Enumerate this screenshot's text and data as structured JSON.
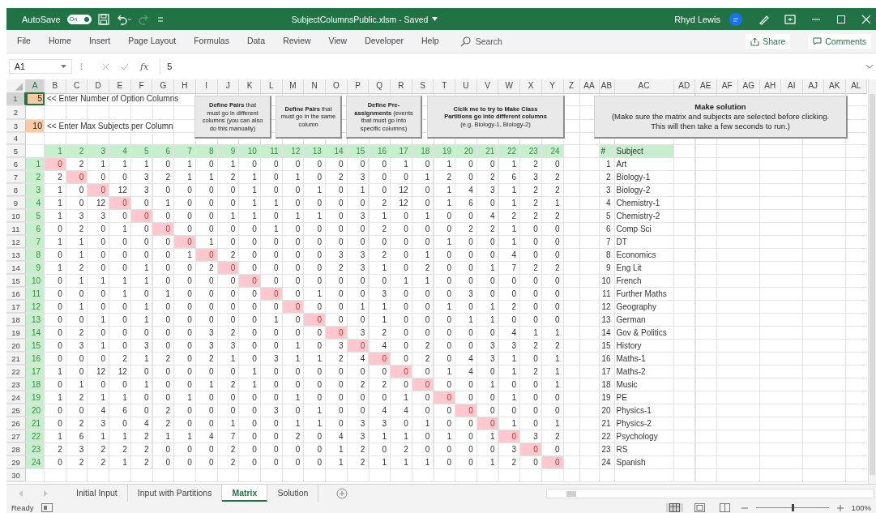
{
  "title_bar": {
    "autosave_label": "AutoSave",
    "autosave_on": true,
    "toggle_text": "On",
    "document_title": "SubjectColumnsPublic.xlsm  -  Saved",
    "user": "Rhyd Lewis"
  },
  "ribbon": {
    "tabs": [
      {
        "label": "File",
        "selected": false
      },
      {
        "label": "Home",
        "selected": false
      },
      {
        "label": "Insert",
        "selected": false
      },
      {
        "label": "Page Layout",
        "selected": false
      },
      {
        "label": "Formulas",
        "selected": false
      },
      {
        "label": "Data",
        "selected": false
      },
      {
        "label": "Review",
        "selected": false
      },
      {
        "label": "View",
        "selected": false
      },
      {
        "label": "Developer",
        "selected": false
      },
      {
        "label": "Help",
        "selected": false
      }
    ],
    "search_placeholder": "Search",
    "share": "Share",
    "comments": "Comments"
  },
  "formula_bar": {
    "name_box": "A1",
    "fx": "fx",
    "value": "5"
  },
  "sheet": {
    "columns": [
      {
        "label": "A",
        "selected": true
      },
      {
        "label": "B",
        "selected": false
      },
      {
        "label": "C",
        "selected": false
      },
      {
        "label": "D",
        "selected": false
      },
      {
        "label": "E",
        "selected": false
      },
      {
        "label": "F",
        "selected": false
      },
      {
        "label": "G",
        "selected": false
      },
      {
        "label": "H",
        "selected": false
      },
      {
        "label": "I",
        "selected": false
      },
      {
        "label": "J",
        "selected": false
      },
      {
        "label": "K",
        "selected": false
      },
      {
        "label": "L",
        "selected": false
      },
      {
        "label": "M",
        "selected": false
      },
      {
        "label": "N",
        "selected": false
      },
      {
        "label": "O",
        "selected": false
      },
      {
        "label": "P",
        "selected": false
      },
      {
        "label": "Q",
        "selected": false
      },
      {
        "label": "R",
        "selected": false
      },
      {
        "label": "S",
        "selected": false
      },
      {
        "label": "T",
        "selected": false
      },
      {
        "label": "U",
        "selected": false
      },
      {
        "label": "V",
        "selected": false
      },
      {
        "label": "W",
        "selected": false
      },
      {
        "label": "X",
        "selected": false
      },
      {
        "label": "Y",
        "selected": false
      },
      {
        "label": "Z",
        "selected": false
      },
      {
        "label": "AA",
        "selected": false
      },
      {
        "label": "AB",
        "selected": false
      },
      {
        "label": "AC",
        "selected": false
      },
      {
        "label": "AD",
        "selected": false
      },
      {
        "label": "AE",
        "selected": false
      },
      {
        "label": "AF",
        "selected": false
      },
      {
        "label": "AG",
        "selected": false
      },
      {
        "label": "AH",
        "selected": false
      },
      {
        "label": "AI",
        "selected": false
      },
      {
        "label": "AJ",
        "selected": false
      },
      {
        "label": "AK",
        "selected": false
      },
      {
        "label": "AL",
        "selected": false
      }
    ],
    "rows": [
      {
        "label": "1",
        "selected": true
      },
      {
        "label": "2",
        "selected": false
      },
      {
        "label": "3",
        "selected": false
      },
      {
        "label": "4",
        "selected": false
      },
      {
        "label": "5",
        "selected": false
      },
      {
        "label": "6",
        "selected": false
      },
      {
        "label": "7",
        "selected": false
      },
      {
        "label": "8",
        "selected": false
      },
      {
        "label": "9",
        "selected": false
      },
      {
        "label": "10",
        "selected": false
      },
      {
        "label": "11",
        "selected": false
      },
      {
        "label": "12",
        "selected": false
      },
      {
        "label": "13",
        "selected": false
      },
      {
        "label": "14",
        "selected": false
      },
      {
        "label": "15",
        "selected": false
      },
      {
        "label": "16",
        "selected": false
      },
      {
        "label": "17",
        "selected": false
      },
      {
        "label": "18",
        "selected": false
      },
      {
        "label": "19",
        "selected": false
      },
      {
        "label": "20",
        "selected": false
      },
      {
        "label": "21",
        "selected": false
      },
      {
        "label": "22",
        "selected": false
      },
      {
        "label": "23",
        "selected": false
      },
      {
        "label": "24",
        "selected": false
      },
      {
        "label": "25",
        "selected": false
      },
      {
        "label": "26",
        "selected": false
      },
      {
        "label": "27",
        "selected": false
      },
      {
        "label": "28",
        "selected": false
      },
      {
        "label": "29",
        "selected": false
      },
      {
        "label": "30",
        "selected": false
      }
    ],
    "inputs": [
      {
        "value": "5",
        "note": "<< Enter Number of Option Columns",
        "selected": true
      },
      {
        "value": "10",
        "note": "<< Enter Max Subjects per Column",
        "selected": false
      }
    ],
    "macro_buttons": [
      {
        "lines": [
          "**Define Pairs** that",
          "must go in different",
          "columns (you can also",
          "do this manually)"
        ]
      },
      {
        "lines": [
          "**Define Pairs** that",
          "must go in the same",
          "column"
        ]
      },
      {
        "lines": [
          "**Define Pre-**",
          "**assignments** (events",
          "that must go into",
          "specific columns)"
        ]
      },
      {
        "lines": [
          "**Clcik me to try to Make Class**",
          "**Partitions go into different columns**",
          "(e.g. Biology-1, Biology-2)"
        ]
      },
      {
        "lines": [
          "**Make solution**",
          "(Make sure the matrix and subjects are selected before clicking.",
          "This will then take a few seconds to run.)"
        ]
      }
    ],
    "matrix": {
      "diagonal_highlighted": true,
      "headers": [
        "1",
        "2",
        "3",
        "4",
        "5",
        "6",
        "7",
        "8",
        "9",
        "10",
        "11",
        "12",
        "13",
        "14",
        "15",
        "16",
        "17",
        "18",
        "19",
        "20",
        "21",
        "22",
        "23",
        "24"
      ],
      "rows": [
        {
          "label": "1",
          "values": [
            "0",
            "2",
            "1",
            "1",
            "1",
            "0",
            "1",
            "0",
            "1",
            "0",
            "0",
            "0",
            "0",
            "0",
            "0",
            "0",
            "1",
            "0",
            "1",
            "0",
            "0",
            "1",
            "2",
            "0"
          ]
        },
        {
          "label": "2",
          "values": [
            "2",
            "0",
            "0",
            "0",
            "3",
            "2",
            "1",
            "1",
            "2",
            "1",
            "0",
            "1",
            "0",
            "2",
            "3",
            "0",
            "0",
            "1",
            "2",
            "0",
            "2",
            "6",
            "3",
            "2"
          ]
        },
        {
          "label": "3",
          "values": [
            "1",
            "0",
            "0",
            "12",
            "3",
            "0",
            "0",
            "0",
            "0",
            "1",
            "0",
            "0",
            "1",
            "0",
            "1",
            "0",
            "12",
            "0",
            "1",
            "4",
            "3",
            "1",
            "2",
            "2"
          ]
        },
        {
          "label": "4",
          "values": [
            "1",
            "0",
            "12",
            "0",
            "0",
            "1",
            "0",
            "0",
            "0",
            "1",
            "1",
            "0",
            "0",
            "0",
            "0",
            "2",
            "12",
            "0",
            "1",
            "6",
            "0",
            "1",
            "2",
            "1"
          ]
        },
        {
          "label": "5",
          "values": [
            "1",
            "3",
            "3",
            "0",
            "0",
            "0",
            "0",
            "0",
            "1",
            "1",
            "0",
            "1",
            "1",
            "0",
            "3",
            "1",
            "0",
            "1",
            "0",
            "0",
            "4",
            "2",
            "2",
            "2"
          ]
        },
        {
          "label": "6",
          "values": [
            "0",
            "2",
            "0",
            "1",
            "0",
            "0",
            "0",
            "0",
            "0",
            "0",
            "1",
            "0",
            "0",
            "0",
            "0",
            "2",
            "0",
            "0",
            "0",
            "2",
            "2",
            "1",
            "0",
            "0"
          ]
        },
        {
          "label": "7",
          "values": [
            "1",
            "1",
            "0",
            "0",
            "0",
            "0",
            "0",
            "1",
            "0",
            "0",
            "0",
            "0",
            "0",
            "0",
            "0",
            "0",
            "0",
            "0",
            "1",
            "0",
            "0",
            "1",
            "0",
            "0"
          ]
        },
        {
          "label": "8",
          "values": [
            "0",
            "1",
            "0",
            "0",
            "0",
            "0",
            "1",
            "0",
            "2",
            "0",
            "0",
            "0",
            "0",
            "3",
            "3",
            "2",
            "0",
            "1",
            "0",
            "0",
            "0",
            "4",
            "0",
            "0"
          ]
        },
        {
          "label": "9",
          "values": [
            "1",
            "2",
            "0",
            "0",
            "1",
            "0",
            "0",
            "2",
            "0",
            "0",
            "0",
            "0",
            "0",
            "2",
            "3",
            "1",
            "0",
            "2",
            "0",
            "0",
            "1",
            "7",
            "2",
            "2"
          ]
        },
        {
          "label": "10",
          "values": [
            "0",
            "1",
            "1",
            "1",
            "1",
            "0",
            "0",
            "0",
            "0",
            "0",
            "0",
            "0",
            "0",
            "0",
            "0",
            "0",
            "1",
            "1",
            "0",
            "0",
            "0",
            "0",
            "0",
            "0"
          ]
        },
        {
          "label": "11",
          "values": [
            "0",
            "0",
            "0",
            "1",
            "0",
            "1",
            "0",
            "0",
            "0",
            "0",
            "0",
            "0",
            "1",
            "0",
            "0",
            "3",
            "0",
            "0",
            "0",
            "3",
            "0",
            "0",
            "0",
            "0"
          ]
        },
        {
          "label": "12",
          "values": [
            "0",
            "1",
            "0",
            "0",
            "1",
            "0",
            "0",
            "0",
            "0",
            "0",
            "0",
            "0",
            "0",
            "0",
            "1",
            "1",
            "0",
            "0",
            "1",
            "0",
            "1",
            "2",
            "0",
            "0"
          ]
        },
        {
          "label": "13",
          "values": [
            "0",
            "0",
            "1",
            "0",
            "1",
            "0",
            "0",
            "0",
            "0",
            "0",
            "1",
            "0",
            "0",
            "0",
            "0",
            "1",
            "0",
            "0",
            "0",
            "1",
            "1",
            "0",
            "0",
            "0"
          ]
        },
        {
          "label": "14",
          "values": [
            "0",
            "2",
            "0",
            "0",
            "0",
            "0",
            "0",
            "3",
            "2",
            "0",
            "0",
            "0",
            "0",
            "0",
            "3",
            "2",
            "0",
            "0",
            "0",
            "0",
            "0",
            "4",
            "1",
            "1"
          ]
        },
        {
          "label": "15",
          "values": [
            "0",
            "3",
            "1",
            "0",
            "3",
            "0",
            "0",
            "3",
            "3",
            "0",
            "0",
            "1",
            "0",
            "3",
            "0",
            "4",
            "0",
            "2",
            "0",
            "0",
            "3",
            "3",
            "2",
            "2"
          ]
        },
        {
          "label": "16",
          "values": [
            "0",
            "0",
            "0",
            "2",
            "1",
            "2",
            "0",
            "2",
            "1",
            "0",
            "3",
            "1",
            "1",
            "2",
            "4",
            "0",
            "0",
            "2",
            "0",
            "4",
            "3",
            "1",
            "0",
            "1"
          ]
        },
        {
          "label": "17",
          "values": [
            "1",
            "0",
            "12",
            "12",
            "0",
            "0",
            "0",
            "0",
            "0",
            "1",
            "0",
            "0",
            "0",
            "0",
            "0",
            "0",
            "0",
            "0",
            "1",
            "4",
            "0",
            "1",
            "2",
            "1"
          ]
        },
        {
          "label": "18",
          "values": [
            "0",
            "1",
            "0",
            "0",
            "1",
            "0",
            "0",
            "1",
            "2",
            "1",
            "0",
            "0",
            "0",
            "0",
            "2",
            "2",
            "0",
            "0",
            "0",
            "0",
            "1",
            "0",
            "0",
            "1"
          ]
        },
        {
          "label": "19",
          "values": [
            "1",
            "2",
            "1",
            "1",
            "0",
            "0",
            "1",
            "0",
            "0",
            "0",
            "0",
            "1",
            "0",
            "0",
            "0",
            "0",
            "1",
            "0",
            "0",
            "0",
            "0",
            "1",
            "0",
            "0"
          ]
        },
        {
          "label": "20",
          "values": [
            "0",
            "0",
            "4",
            "6",
            "0",
            "2",
            "0",
            "0",
            "0",
            "0",
            "3",
            "0",
            "1",
            "0",
            "0",
            "4",
            "4",
            "0",
            "0",
            "0",
            "0",
            "0",
            "0",
            "0"
          ]
        },
        {
          "label": "21",
          "values": [
            "0",
            "2",
            "3",
            "0",
            "4",
            "2",
            "0",
            "0",
            "1",
            "0",
            "0",
            "1",
            "1",
            "0",
            "3",
            "3",
            "0",
            "1",
            "0",
            "0",
            "0",
            "1",
            "0",
            "1"
          ]
        },
        {
          "label": "22",
          "values": [
            "1",
            "6",
            "1",
            "1",
            "2",
            "1",
            "1",
            "4",
            "7",
            "0",
            "0",
            "2",
            "0",
            "4",
            "3",
            "1",
            "1",
            "0",
            "1",
            "0",
            "1",
            "0",
            "3",
            "2"
          ]
        },
        {
          "label": "23",
          "values": [
            "2",
            "3",
            "2",
            "2",
            "2",
            "0",
            "0",
            "0",
            "2",
            "0",
            "0",
            "0",
            "0",
            "1",
            "2",
            "0",
            "2",
            "0",
            "0",
            "0",
            "0",
            "3",
            "0",
            "0"
          ]
        },
        {
          "label": "24",
          "values": [
            "0",
            "2",
            "2",
            "1",
            "2",
            "0",
            "0",
            "0",
            "2",
            "0",
            "0",
            "0",
            "0",
            "1",
            "2",
            "1",
            "1",
            "1",
            "0",
            "0",
            "1",
            "2",
            "0",
            "0"
          ]
        }
      ]
    },
    "subjects": {
      "number_heading": "#",
      "name_heading": "Subject",
      "items": [
        {
          "number": "1",
          "name": "Art"
        },
        {
          "number": "2",
          "name": "Biology-1"
        },
        {
          "number": "3",
          "name": "Biology-2"
        },
        {
          "number": "4",
          "name": "Chemistry-1"
        },
        {
          "number": "5",
          "name": "Chemistry-2"
        },
        {
          "number": "6",
          "name": "Comp Sci"
        },
        {
          "number": "7",
          "name": "DT"
        },
        {
          "number": "8",
          "name": "Economics"
        },
        {
          "number": "9",
          "name": "Eng Lit"
        },
        {
          "number": "10",
          "name": "French"
        },
        {
          "number": "11",
          "name": "Further Maths"
        },
        {
          "number": "12",
          "name": "Geography"
        },
        {
          "number": "13",
          "name": "German"
        },
        {
          "number": "14",
          "name": "Gov & Politics"
        },
        {
          "number": "15",
          "name": "History"
        },
        {
          "number": "16",
          "name": "Maths-1"
        },
        {
          "number": "17",
          "name": "Maths-2"
        },
        {
          "number": "18",
          "name": "Music"
        },
        {
          "number": "19",
          "name": "PE"
        },
        {
          "number": "20",
          "name": "Physics-1"
        },
        {
          "number": "21",
          "name": "Physics-2"
        },
        {
          "number": "22",
          "name": "Psychology"
        },
        {
          "number": "23",
          "name": "RS"
        },
        {
          "number": "24",
          "name": "Spanish"
        }
      ]
    }
  },
  "sheet_tabs": [
    {
      "label": "Initial Input",
      "selected": false
    },
    {
      "label": "Input with Partitions",
      "selected": false
    },
    {
      "label": "Matrix",
      "selected": true
    },
    {
      "label": "Solution",
      "selected": false
    }
  ],
  "status_bar": {
    "status": "Ready",
    "zoom": "100%",
    "zoom_slider": {
      "level": 0.5
    }
  }
}
